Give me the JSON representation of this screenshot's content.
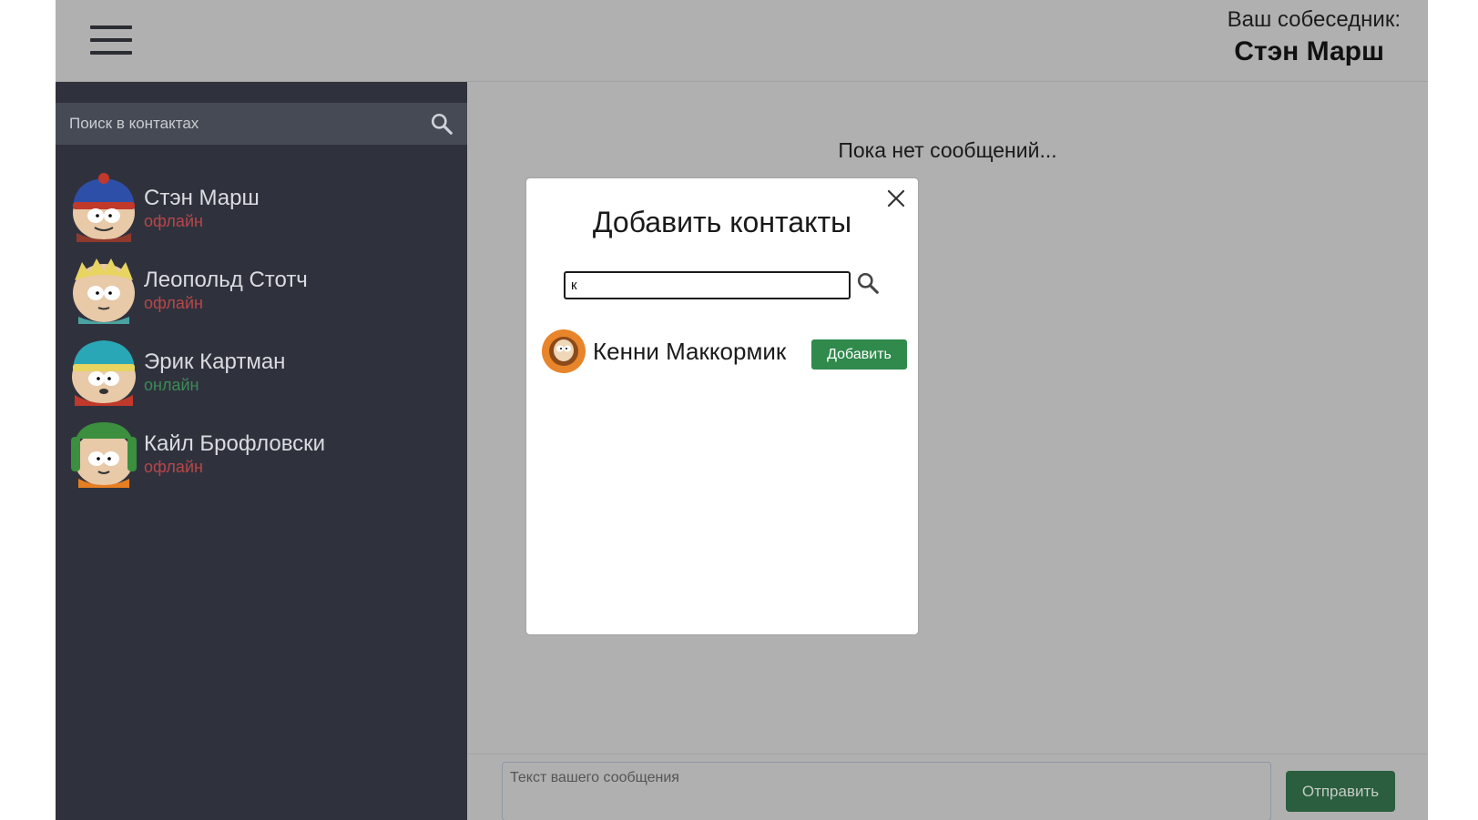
{
  "header": {
    "interlocutor_label": "Ваш собеседник:",
    "interlocutor_name": "Стэн Марш"
  },
  "sidebar": {
    "search_placeholder": "Поиск в контактах",
    "contacts": [
      {
        "name": "Стэн Марш",
        "status": "офлайн",
        "status_color": "#b8464a"
      },
      {
        "name": "Леопольд Стотч",
        "status": "офлайн",
        "status_color": "#b8464a"
      },
      {
        "name": "Эрик Картман",
        "status": "онлайн",
        "status_color": "#3d8a56"
      },
      {
        "name": "Кайл Брофловски",
        "status": "офлайн",
        "status_color": "#b8464a"
      }
    ]
  },
  "main": {
    "empty_message": "Пока нет сообщений...",
    "message_placeholder": "Текст вашего сообщения",
    "send_label": "Отправить"
  },
  "modal": {
    "title": "Добавить контакты",
    "search_value": "к",
    "results": [
      {
        "name": "Кенни Маккормик",
        "add_label": "Добавить"
      }
    ]
  },
  "colors": {
    "sidebar_bg": "#2f323d",
    "main_bg": "#b0b0b0",
    "accent_green": "#2f8a4c",
    "offline": "#b8464a",
    "online": "#3d8a56"
  }
}
